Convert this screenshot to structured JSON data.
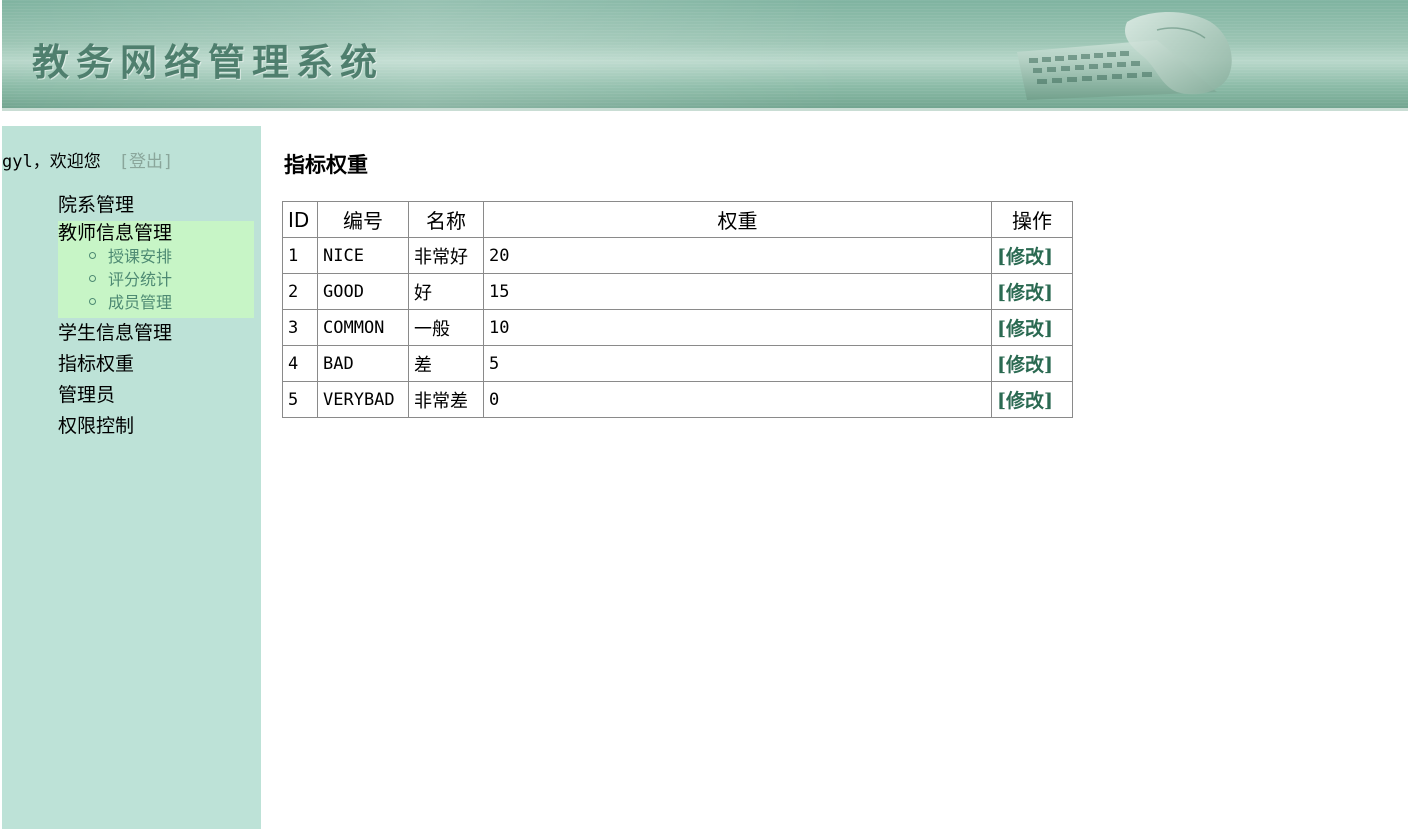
{
  "header": {
    "title": "教务网络管理系统"
  },
  "sidebar": {
    "user_name": "gyl，欢迎您",
    "logout_label": "[登出]",
    "items": [
      {
        "label": "院系管理"
      },
      {
        "label": "教师信息管理",
        "children": [
          {
            "label": "授课安排"
          },
          {
            "label": "评分统计"
          },
          {
            "label": "成员管理"
          }
        ]
      },
      {
        "label": "学生信息管理"
      },
      {
        "label": "指标权重"
      },
      {
        "label": "管理员"
      },
      {
        "label": "权限控制"
      }
    ]
  },
  "main": {
    "title": "指标权重",
    "table": {
      "headers": [
        "ID",
        "编号",
        "名称",
        "权重",
        "操作"
      ],
      "rows": [
        {
          "id": "1",
          "code": "NICE",
          "name": "非常好",
          "weight": "20",
          "action": "[修改]"
        },
        {
          "id": "2",
          "code": "GOOD",
          "name": "好",
          "weight": "15",
          "action": "[修改]"
        },
        {
          "id": "3",
          "code": "COMMON",
          "name": "一般",
          "weight": "10",
          "action": "[修改]"
        },
        {
          "id": "4",
          "code": "BAD",
          "name": "差",
          "weight": "5",
          "action": "[修改]"
        },
        {
          "id": "5",
          "code": "VERYBAD",
          "name": "非常差",
          "weight": "0",
          "action": "[修改]"
        }
      ]
    }
  },
  "colors": {
    "sidebar_bg": "#bde2d7",
    "submenu_bg": "#c7f5c6",
    "link": "#2b6a52",
    "header_title": "#4f7f6e"
  }
}
